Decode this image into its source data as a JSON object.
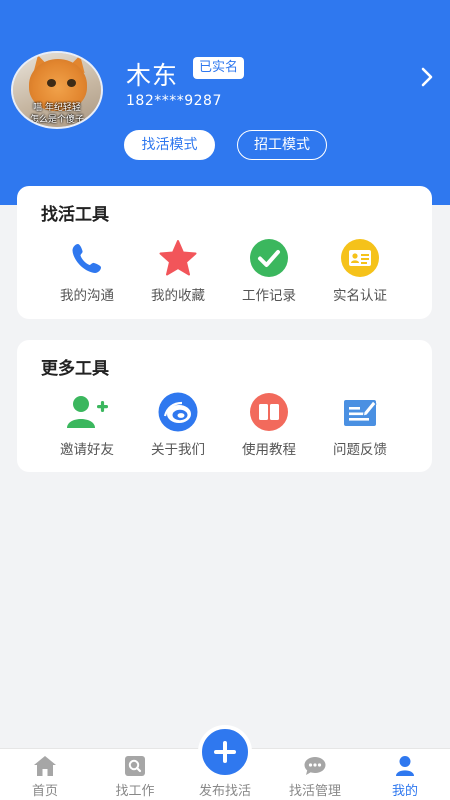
{
  "profile": {
    "name": "木东",
    "verified_badge": "已实名",
    "phone": "182****9287",
    "avatar_caption_line1": "喵 年纪轻轻",
    "avatar_caption_line2": "怎么是个傻子",
    "modes": {
      "find_work": "找活模式",
      "recruit": "招工模式"
    }
  },
  "find_tools": {
    "title": "找活工具",
    "items": [
      {
        "label": "我的沟通",
        "icon": "phone-icon",
        "color": "#2f78ef"
      },
      {
        "label": "我的收藏",
        "icon": "star-icon",
        "color": "#f2555a"
      },
      {
        "label": "工作记录",
        "icon": "check-circle-icon",
        "color": "#3bb75e"
      },
      {
        "label": "实名认证",
        "icon": "id-card-icon",
        "color": "#f5c21a"
      }
    ]
  },
  "more_tools": {
    "title": "更多工具",
    "items": [
      {
        "label": "邀请好友",
        "icon": "add-user-icon",
        "color": "#3bb75e"
      },
      {
        "label": "关于我们",
        "icon": "about-logo-icon",
        "color": "#2f78ef"
      },
      {
        "label": "使用教程",
        "icon": "book-icon",
        "color": "#f26a5c"
      },
      {
        "label": "问题反馈",
        "icon": "feedback-icon",
        "color": "#4a90e2"
      }
    ]
  },
  "tabbar": {
    "items": [
      {
        "label": "首页",
        "icon": "home-icon"
      },
      {
        "label": "找工作",
        "icon": "search-job-icon"
      },
      {
        "label": "发布找活",
        "icon": "plus-icon"
      },
      {
        "label": "找活管理",
        "icon": "chat-icon"
      },
      {
        "label": "我的",
        "icon": "user-icon",
        "active": true
      }
    ]
  },
  "colors": {
    "primary": "#2f78ef",
    "background": "#f2f3f5"
  }
}
